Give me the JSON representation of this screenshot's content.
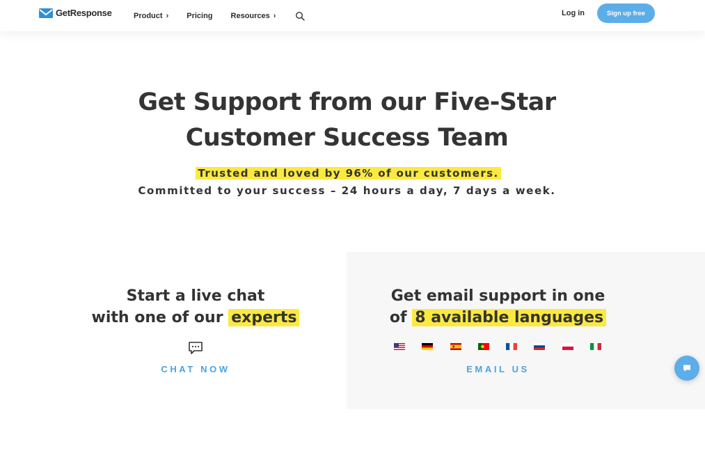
{
  "header": {
    "logo_text": "GetResponse",
    "nav": [
      {
        "label": "Product",
        "has_chevron": true
      },
      {
        "label": "Pricing",
        "has_chevron": false
      },
      {
        "label": "Resources",
        "has_chevron": true
      }
    ],
    "chevron_glyph": "›",
    "login_label": "Log in",
    "signup_label": "Sign up free"
  },
  "hero": {
    "title_line1": "Get Support from our Five-Star",
    "title_line2": "Customer Success Team",
    "highlight": "Trusted and loved by 96% of our customers.",
    "subtitle": "Committed to your success – 24 hours a day, 7 days a week."
  },
  "chat_card": {
    "title_line1": "Start a live chat",
    "title_line2_prefix": "with one of our",
    "title_line2_highlight": "experts",
    "cta": "CHAT NOW"
  },
  "email_card": {
    "title_line1": "Get email support in one",
    "title_line2_prefix": "of",
    "title_line2_highlight": "8 available languages",
    "flags": [
      "us-flag-icon",
      "de-flag-icon",
      "es-flag-icon",
      "pt-flag-icon",
      "fr-flag-icon",
      "ru-flag-icon",
      "pl-flag-icon",
      "it-flag-icon"
    ],
    "cta": "EMAIL US"
  },
  "colors": {
    "accent": "#5dade9",
    "link": "#4aa3e0",
    "highlight": "#fbe93f",
    "card_bg": "#f7f7f7"
  }
}
